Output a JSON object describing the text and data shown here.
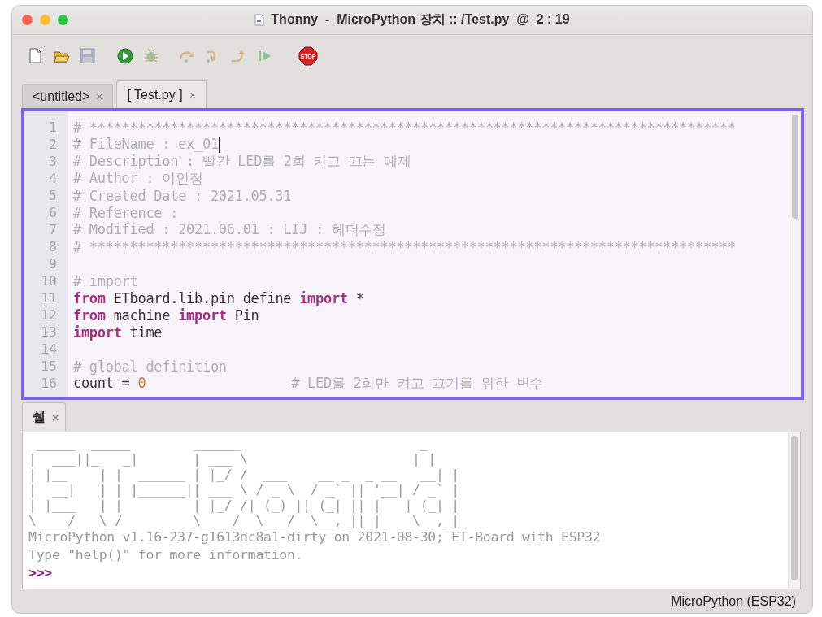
{
  "window": {
    "title": "Thonny  -  MicroPython 장치 :: /Test.py  @  2 : 19"
  },
  "toolbar": [
    {
      "kind": "new",
      "disabled": false
    },
    {
      "kind": "open",
      "disabled": false
    },
    {
      "kind": "save",
      "disabled": true
    },
    {
      "kind": "run",
      "disabled": false
    },
    {
      "kind": "debug",
      "disabled": true
    },
    {
      "kind": "step-over",
      "disabled": true
    },
    {
      "kind": "step-into",
      "disabled": true
    },
    {
      "kind": "step-out",
      "disabled": true
    },
    {
      "kind": "resume",
      "disabled": true
    },
    {
      "kind": "stop",
      "label": "STOP",
      "disabled": false
    }
  ],
  "editor_tabs": [
    {
      "label": "<untitled>",
      "close": "×",
      "selected": false
    },
    {
      "label": "[ Test.py ]",
      "close": "×",
      "selected": true
    }
  ],
  "editor": {
    "lines": [
      {
        "number": "1",
        "cursor": false,
        "tokens": [
          {
            "kind": "comment",
            "text": "# ********************************************************************************"
          }
        ]
      },
      {
        "number": "2",
        "cursor": true,
        "tokens": [
          {
            "kind": "comment",
            "text": "# FileName : ex_01"
          }
        ]
      },
      {
        "number": "3",
        "cursor": false,
        "tokens": [
          {
            "kind": "comment",
            "text": "# Description : 빨간 LED를 2회 켜고 끄는 예제"
          }
        ]
      },
      {
        "number": "4",
        "cursor": false,
        "tokens": [
          {
            "kind": "comment",
            "text": "# Author : 이인정"
          }
        ]
      },
      {
        "number": "5",
        "cursor": false,
        "tokens": [
          {
            "kind": "comment",
            "text": "# Created Date : 2021.05.31"
          }
        ]
      },
      {
        "number": "6",
        "cursor": false,
        "tokens": [
          {
            "kind": "comment",
            "text": "# Reference :"
          }
        ]
      },
      {
        "number": "7",
        "cursor": false,
        "tokens": [
          {
            "kind": "comment",
            "text": "# Modified : 2021.06.01 : LIJ : 헤더수정"
          }
        ]
      },
      {
        "number": "8",
        "cursor": false,
        "tokens": [
          {
            "kind": "comment",
            "text": "# ********************************************************************************"
          }
        ]
      },
      {
        "number": "9",
        "cursor": false
      },
      {
        "number": "10",
        "cursor": false,
        "tokens": [
          {
            "kind": "comment",
            "text": "# import"
          }
        ]
      },
      {
        "number": "11",
        "cursor": false,
        "tokens": [
          {
            "kind": "keyword",
            "text": "from"
          },
          {
            "kind": "plain",
            "text": " ETboard.lib.pin_define "
          },
          {
            "kind": "keyword",
            "text": "import"
          },
          {
            "kind": "plain",
            "text": " *"
          }
        ]
      },
      {
        "number": "12",
        "cursor": false,
        "tokens": [
          {
            "kind": "keyword",
            "text": "from"
          },
          {
            "kind": "plain",
            "text": " machine "
          },
          {
            "kind": "keyword",
            "text": "import"
          },
          {
            "kind": "plain",
            "text": " Pin"
          }
        ]
      },
      {
        "number": "13",
        "cursor": false,
        "tokens": [
          {
            "kind": "keyword",
            "text": "import"
          },
          {
            "kind": "plain",
            "text": " time"
          }
        ]
      },
      {
        "number": "14",
        "cursor": false
      },
      {
        "number": "15",
        "cursor": false,
        "tokens": [
          {
            "kind": "comment",
            "text": "# global definition"
          }
        ]
      },
      {
        "number": "16",
        "cursor": false,
        "tokens": [
          {
            "kind": "plain",
            "text": "count = "
          },
          {
            "kind": "number",
            "text": "0"
          },
          {
            "kind": "comment",
            "text": "                  # LED를 2회만 켜고 끄기를 위한 변수"
          }
        ]
      }
    ]
  },
  "shell_tabs": [
    {
      "label": "쉘",
      "close": "×",
      "selected": true
    }
  ],
  "shell": {
    "banner": [
      " _____  _____        ______                       _ ",
      "|  ___||_   _|       | ___ \\                     | |",
      "| |__    | |  ______ | |_/ /  ___    __ _  _ __   __| |",
      "|  __|   | | |______|| ___ \\ / _ \\  / _` || '__| / _` |",
      "| |___   | |         | |_/ /| (_) || (_| || |   | (_| |",
      "\\____/   \\_/         \\____/  \\___/  \\__,_||_|    \\__,_|"
    ],
    "output": [
      "MicroPython v1.16-237-g1613dc8a1-dirty on 2021-08-30; ET-Board with ESP32",
      "Type \"help()\" for more information."
    ],
    "prompt": ">>>"
  },
  "status_bar": {
    "interpreter": "MicroPython (ESP32)"
  }
}
